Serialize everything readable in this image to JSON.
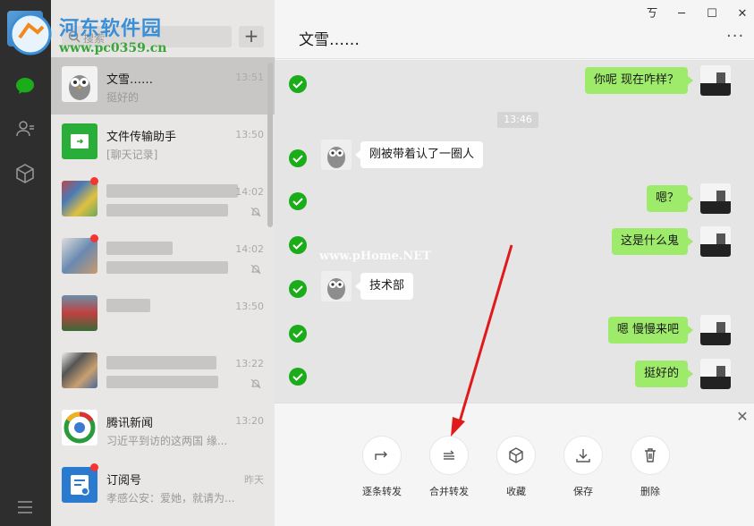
{
  "watermark": {
    "site_name": "河东软件园",
    "url": "www.pc0359.cn",
    "overlay": "www.pHome.NET"
  },
  "search": {
    "placeholder": "搜索"
  },
  "conversations": [
    {
      "name": "文雪……",
      "preview": "挺好的",
      "time": "13:51",
      "active": true
    },
    {
      "name": "文件传输助手",
      "preview": "[聊天记录]",
      "time": "13:50"
    },
    {
      "name": "",
      "preview": "",
      "time": "14:02",
      "unread": true,
      "muted": true
    },
    {
      "name": "",
      "preview": "",
      "time": "14:02",
      "unread": true,
      "muted": true
    },
    {
      "name": "",
      "preview": "",
      "time": "13:50"
    },
    {
      "name": "",
      "preview": "",
      "time": "13:22",
      "muted": true
    },
    {
      "name": "腾讯新闻",
      "preview": "习近平到访的这两国 缘...",
      "time": "13:20"
    },
    {
      "name": "订阅号",
      "preview": "孝感公安：爱她，就请为...",
      "time": "昨天",
      "unread": true
    }
  ],
  "chat": {
    "title": "文雪……",
    "window_controls": {
      "pin": "ㄎ",
      "minimize": "─",
      "maximize": "☐",
      "close": "✕"
    },
    "more": "···",
    "time_separator": "13:46",
    "messages": [
      {
        "side": "mine",
        "text": "你呢 现在咋样？"
      },
      {
        "side": "theirs",
        "text": "刚被带着认了一圈人"
      },
      {
        "side": "mine",
        "text": "嗯？"
      },
      {
        "side": "mine",
        "text": "这是什么鬼"
      },
      {
        "side": "theirs",
        "text": "技术部"
      },
      {
        "side": "mine",
        "text": "嗯 慢慢来吧"
      },
      {
        "side": "mine",
        "text": "挺好的"
      }
    ]
  },
  "actions": [
    {
      "label": "逐条转发",
      "icon": "forward-icon"
    },
    {
      "label": "合并转发",
      "icon": "merge-forward-icon"
    },
    {
      "label": "收藏",
      "icon": "cube-icon"
    },
    {
      "label": "保存",
      "icon": "download-icon"
    },
    {
      "label": "删除",
      "icon": "trash-icon"
    }
  ],
  "colors": {
    "accent_green": "#1aad19",
    "bubble_mine": "#9eea6a",
    "unread_dot": "#f43530",
    "arrow": "#e0191b"
  }
}
